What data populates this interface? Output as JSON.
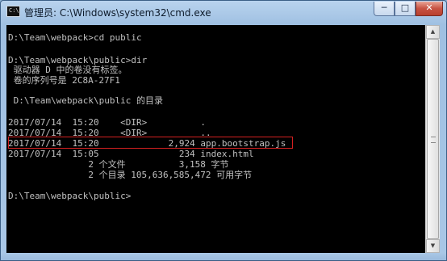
{
  "window": {
    "title": "管理员: C:\\Windows\\system32\\cmd.exe",
    "icon_label": "C:\\",
    "controls": {
      "minimize": "─",
      "maximize": "□",
      "close": "✕"
    }
  },
  "console": {
    "lines": [
      "",
      "D:\\Team\\webpack>cd public",
      "",
      "D:\\Team\\webpack\\public>dir",
      " 驱动器 D 中的卷没有标签。",
      " 卷的序列号是 2C8A-27F1",
      "",
      " D:\\Team\\webpack\\public 的目录",
      "",
      "2017/07/14  15:20    <DIR>          .",
      "2017/07/14  15:20    <DIR>          ..",
      "2017/07/14  15:20             2,924 app.bootstrap.js",
      "2017/07/14  15:05               234 index.html",
      "               2 个文件          3,158 字节",
      "               2 个目录 105,636,585,472 可用字节",
      "",
      "D:\\Team\\webpack\\public>"
    ]
  },
  "scrollbar": {
    "up_icon": "▲",
    "down_icon": "▼"
  },
  "colors": {
    "console_bg": "#000000",
    "console_text": "#c0c0c0",
    "highlight": "#d42020"
  }
}
